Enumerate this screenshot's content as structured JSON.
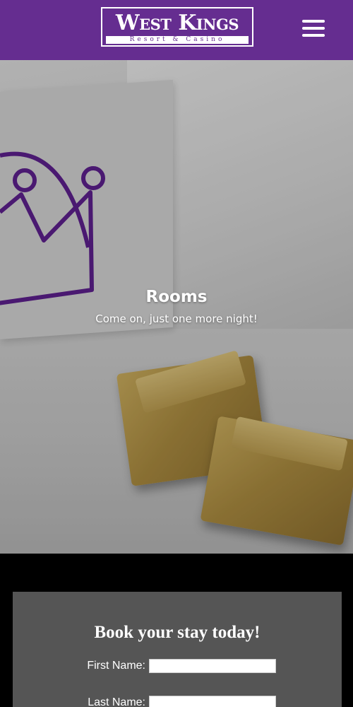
{
  "header": {
    "logo_main": "West Kings",
    "logo_sub": "Resort & Casino",
    "menu_icon": "hamburger-menu-icon",
    "bg_color": "#652d90"
  },
  "hero": {
    "title": "Rooms",
    "subtitle": "Come on, just one more night!"
  },
  "booking": {
    "title": "Book your stay today!",
    "fields": [
      {
        "label": "First Name:",
        "value": ""
      },
      {
        "label": "Last Name:",
        "value": ""
      }
    ],
    "bg_color": "#555555"
  }
}
